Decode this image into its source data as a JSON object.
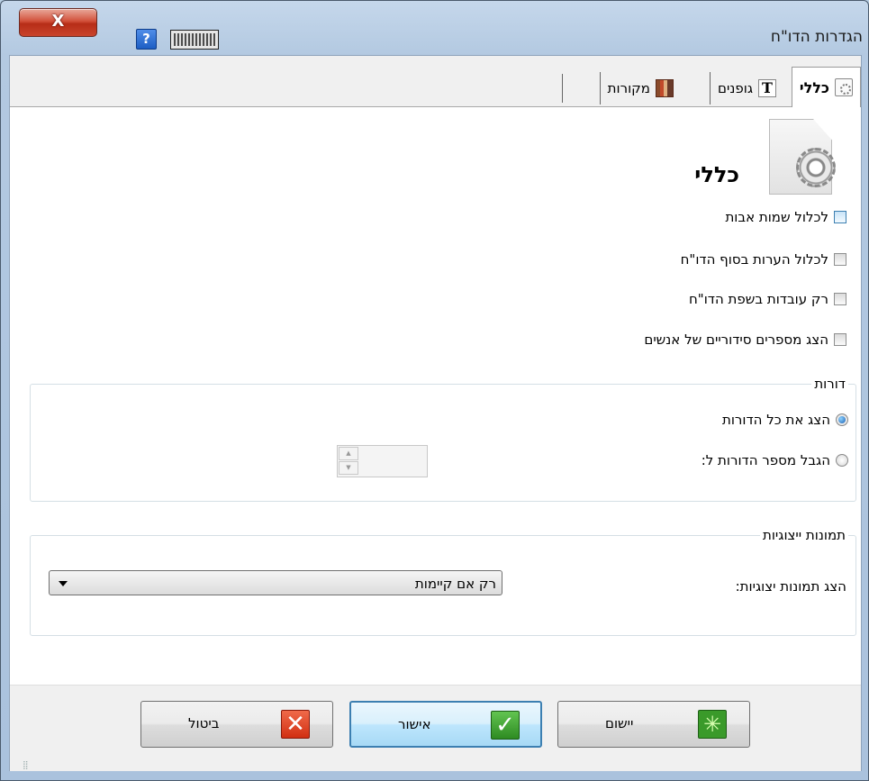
{
  "window": {
    "title": "הגדרות הדו\"ח",
    "close_label": "X",
    "help_label": "?"
  },
  "tabs": [
    {
      "label": "כללי",
      "icon": "general-settings-icon",
      "active": true
    },
    {
      "label": "גופנים",
      "icon": "font-icon",
      "active": false
    },
    {
      "label": "מקורות",
      "icon": "sources-icon",
      "active": false
    }
  ],
  "general": {
    "heading": "כללי",
    "checkboxes": [
      {
        "label": "לכלול שמות אבות",
        "checked": false
      },
      {
        "label": "לכלול הערות בסוף הדו\"ח",
        "checked": false
      },
      {
        "label": "רק עובדות בשפת הדו\"ח",
        "checked": false
      },
      {
        "label": "הצג מספרים סידוריים של אנשים",
        "checked": false
      }
    ]
  },
  "generations": {
    "legend": "דורות",
    "show_all_label": "הצג את כל הדורות",
    "limit_label": "הגבל מספר הדורות ל:",
    "selected": "show_all",
    "spinner_value": ""
  },
  "pictures": {
    "legend": "תמונות ייצוגיות",
    "label": "הצג תמונות יצוגיות:",
    "selected_option": "רק אם קיימות"
  },
  "buttons": {
    "cancel": "ביטול",
    "ok": "אישור",
    "apply": "יישום"
  },
  "colors": {
    "accent": "#3c7fb1",
    "window_frame": "#b9cfe4",
    "close_button": "#c9442c"
  }
}
